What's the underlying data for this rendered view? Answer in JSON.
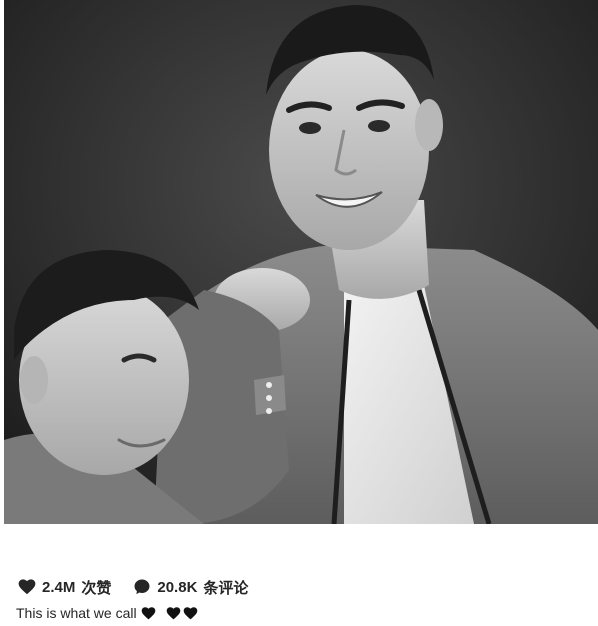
{
  "post": {
    "photo": {
      "description_icon": "photo"
    },
    "likes": {
      "icon": "heart-icon",
      "count": "2.4M",
      "label": "次赞"
    },
    "comments": {
      "icon": "comment-bubble-icon",
      "count": "20.8K",
      "label": "条评论"
    },
    "caption": {
      "text": "This is what we call",
      "emoji_icons": [
        "black-heart-icon",
        "black-heart-icon",
        "black-heart-icon"
      ]
    }
  },
  "colors": {
    "text": "#262626",
    "photo_bg": "#2a2a2a"
  }
}
